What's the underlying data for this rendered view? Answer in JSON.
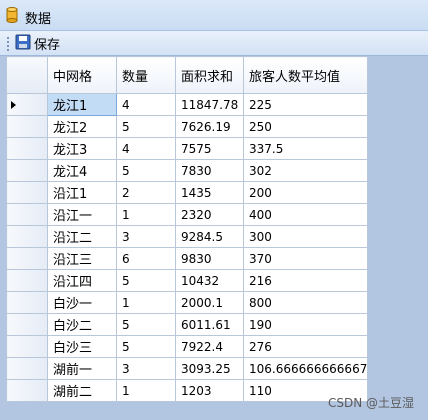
{
  "window": {
    "title": "数据"
  },
  "toolbar": {
    "save_label": "保存"
  },
  "grid": {
    "columns": [
      "中网格",
      "数量",
      "面积求和",
      "旅客人数平均值"
    ],
    "rows": [
      [
        "龙江1",
        "4",
        "11847.78",
        "225"
      ],
      [
        "龙江2",
        "5",
        "7626.19",
        "250"
      ],
      [
        "龙江3",
        "4",
        "7575",
        "337.5"
      ],
      [
        "龙江4",
        "5",
        "7830",
        "302"
      ],
      [
        "沿江1",
        "2",
        "1435",
        "200"
      ],
      [
        "沿江一",
        "1",
        "2320",
        "400"
      ],
      [
        "沿江二",
        "3",
        "9284.5",
        "300"
      ],
      [
        "沿江三",
        "6",
        "9830",
        "370"
      ],
      [
        "沿江四",
        "5",
        "10432",
        "216"
      ],
      [
        "白沙一",
        "1",
        "2000.1",
        "800"
      ],
      [
        "白沙二",
        "5",
        "6011.61",
        "190"
      ],
      [
        "白沙三",
        "5",
        "7922.4",
        "276"
      ],
      [
        "湖前一",
        "3",
        "3093.25",
        "106.666666666667"
      ],
      [
        "湖前二",
        "1",
        "1203",
        "110"
      ]
    ]
  },
  "watermark": "CSDN @土豆湿"
}
